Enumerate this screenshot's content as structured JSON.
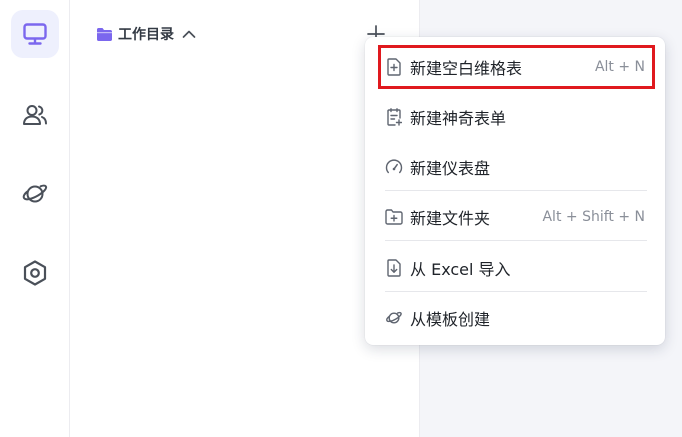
{
  "sidebar": {
    "items": [
      {
        "icon": "monitor-icon",
        "active": true
      },
      {
        "icon": "users-icon",
        "active": false
      },
      {
        "icon": "planet-icon",
        "active": false
      },
      {
        "icon": "hexagon-settings-icon",
        "active": false
      }
    ]
  },
  "panel": {
    "title": "工作目录",
    "folder_icon": "folder-icon",
    "collapse_icon": "chevron-up-icon",
    "add_icon": "plus-icon"
  },
  "menu": {
    "items": [
      {
        "label": "新建空白维格表",
        "shortcut": "Alt + N",
        "icon": "file-plus-icon",
        "highlighted": true
      },
      {
        "label": "新建神奇表单",
        "shortcut": "",
        "icon": "form-icon"
      },
      {
        "label": "新建仪表盘",
        "shortcut": "",
        "icon": "dashboard-gauge-icon"
      },
      {
        "label": "新建文件夹",
        "shortcut": "Alt + Shift + N",
        "icon": "folder-plus-icon"
      },
      {
        "label": "从 Excel 导入",
        "shortcut": "",
        "icon": "file-import-icon"
      },
      {
        "label": "从模板创建",
        "shortcut": "",
        "icon": "planet-icon"
      }
    ]
  },
  "colors": {
    "accent": "#7b67ee",
    "highlight": "#e0191e",
    "icon_gray": "#5f6570"
  }
}
